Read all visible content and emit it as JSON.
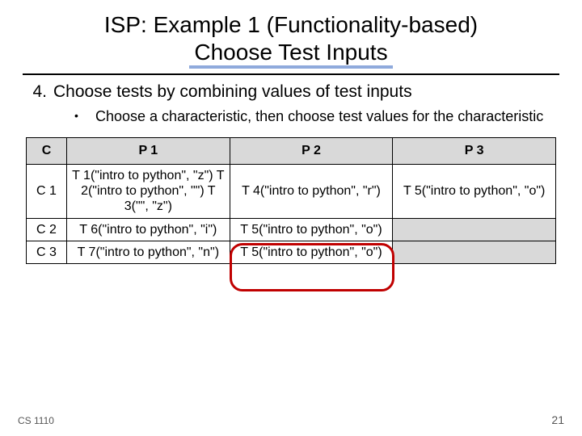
{
  "title": {
    "line1": "ISP: Example 1 (Functionality-based)",
    "line2": "Choose Test Inputs"
  },
  "step4_num": "4.",
  "step4_text": "Choose tests by combining values of test inputs",
  "bullet_text": "Choose a characteristic, then choose test values for the characteristic",
  "table": {
    "headers": {
      "c": "C",
      "p1": "P 1",
      "p2": "P 2",
      "p3": "P 3"
    },
    "rows": [
      {
        "label": "C 1",
        "p1": "T 1(\"intro to python\", \"z\") T 2(\"intro to python\", \"\") T 3(\"\", \"z\")",
        "p2": "T 4(\"intro to python\", \"r\")",
        "p3": "T 5(\"intro to python\", \"o\")"
      },
      {
        "label": "C 2",
        "p1": "T 6(\"intro to python\", \"i\")",
        "p2": "T 5(\"intro to python\", \"o\")",
        "p3": ""
      },
      {
        "label": "C 3",
        "p1": "T 7(\"intro to python\", \"n\")",
        "p2": "T 5(\"intro to python\", \"o\")",
        "p3": ""
      }
    ]
  },
  "footer": {
    "course": "CS 1110",
    "page": "21"
  }
}
